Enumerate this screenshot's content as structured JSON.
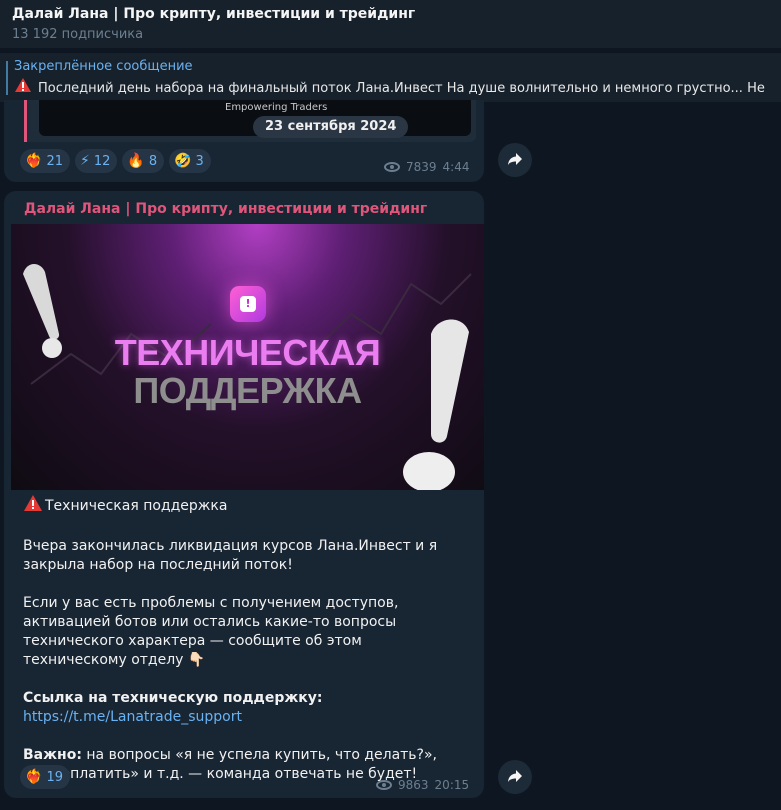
{
  "header": {
    "title": "Далай Лана | Про крипту, инвестиции и трейдинг",
    "subscribers": "13 192 подписчика"
  },
  "pinned": {
    "label": "Закреплённое сообщение",
    "text": "Последний день набора на финальный поток Лана.Инвест  На душе волнительно и немного грустно...  Не",
    "icon": "warning-icon"
  },
  "post1": {
    "reply_image_text": "Empowering Traders",
    "date_pill": "23 сентября 2024",
    "reactions": [
      {
        "emoji": "❤️‍🔥",
        "count": "21"
      },
      {
        "emoji": "⚡",
        "count": "12"
      },
      {
        "emoji": "🔥",
        "count": "8"
      },
      {
        "emoji": "🤣",
        "count": "3"
      }
    ],
    "views": "7839",
    "time": "4:44"
  },
  "post2": {
    "author": "Далай Лана | Про крипту, инвестиции и трейдинг",
    "poster": {
      "badge": "!",
      "line1": "ТЕХНИЧЕСКАЯ",
      "line2": "ПОДДЕРЖКА"
    },
    "title": "Техническая поддержка",
    "p1": "Вчера закончилась ликвидация курсов Лана.Инвест и я закрыла набор на последний поток!",
    "p2": "Если у вас есть проблемы с получением доступов, активацией ботов или остались какие-то вопросы технического характера — сообщите об этом техническому отделу 👇🏻",
    "link_label": "Ссылка на техническую поддержку:",
    "link": "https://t.me/Lanatrade_support",
    "important_label": "Важно:",
    "important_text": " на вопросы «я не успела купить, что делать?», «как оплатить» и т.д. — команда отвечать не будет!",
    "reactions": [
      {
        "emoji": "❤️‍🔥",
        "count": "19"
      }
    ],
    "views": "9863",
    "time": "20:15"
  },
  "colors": {
    "background": "#0e1621",
    "bubble": "#182533",
    "accent": "#6ab2f2",
    "author": "#e0567a"
  }
}
